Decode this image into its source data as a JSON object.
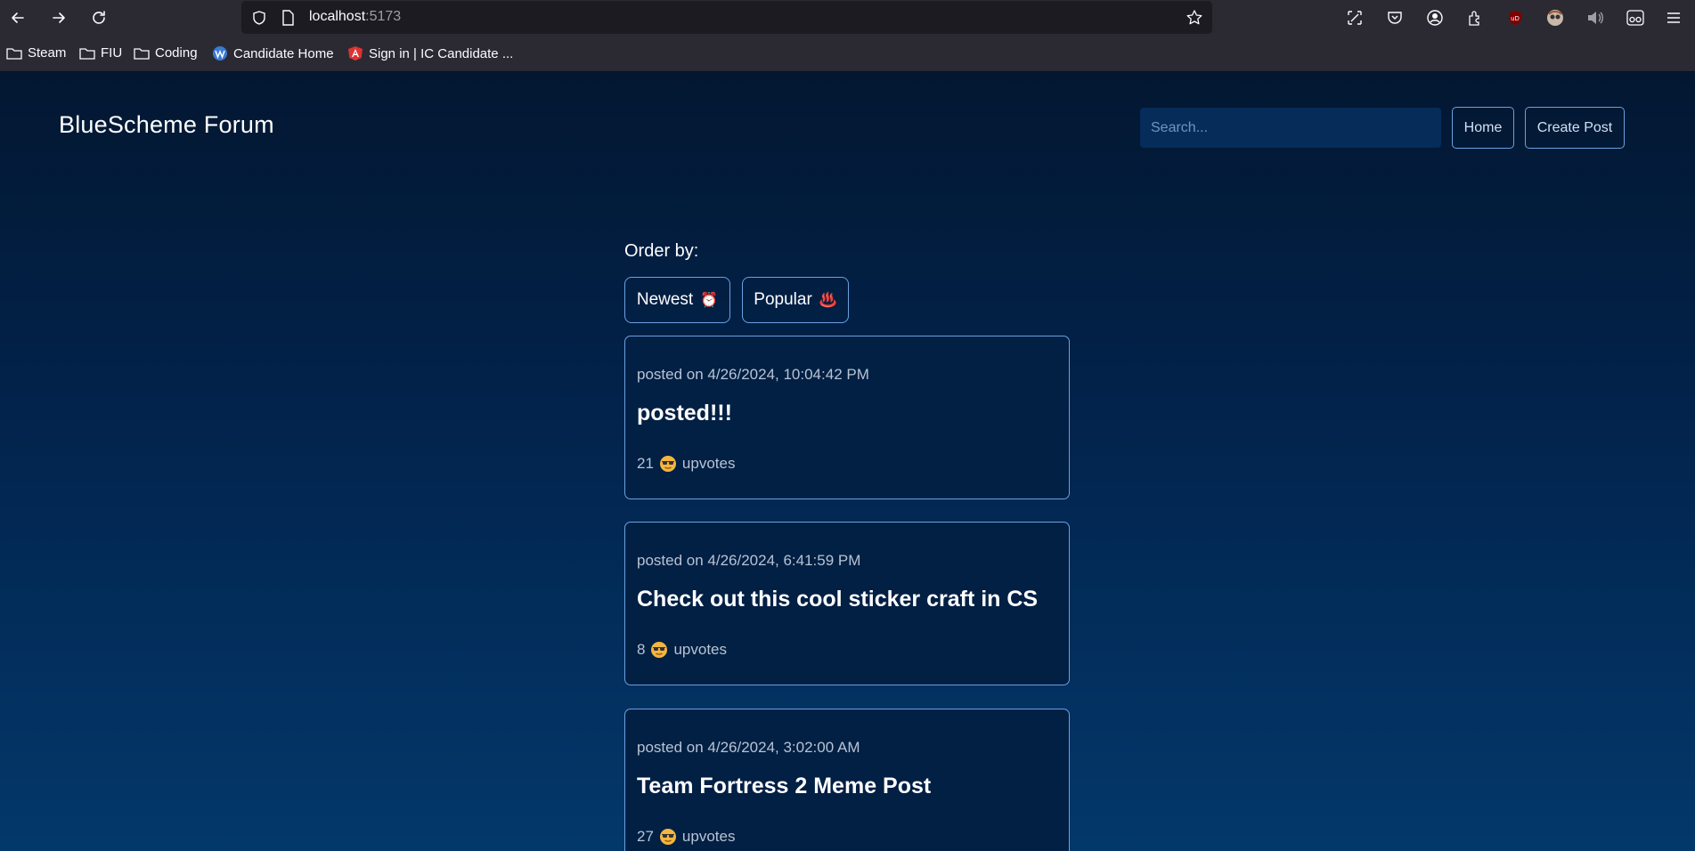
{
  "browser": {
    "url_host": "localhost",
    "url_port": ":5173",
    "bookmarks": [
      {
        "label": "Steam",
        "icon": "folder-icon"
      },
      {
        "label": "FIU",
        "icon": "folder-icon"
      },
      {
        "label": "Coding",
        "icon": "folder-icon"
      },
      {
        "label": "Candidate Home",
        "icon": "candidate-logo-icon"
      },
      {
        "label": "Sign in | IC Candidate ...",
        "icon": "angular-logo-icon"
      }
    ]
  },
  "header": {
    "title": "BlueScheme Forum",
    "search_placeholder": "Search...",
    "home_label": "Home",
    "create_label": "Create Post"
  },
  "sort": {
    "label": "Order by:",
    "newest_label": "Newest",
    "newest_icon": "⏰",
    "popular_label": "Popular",
    "popular_icon": "♨️"
  },
  "posts": [
    {
      "date": "posted on 4/26/2024, 10:04:42 PM",
      "title": "posted!!!",
      "votes": "21",
      "votes_suffix": "upvotes"
    },
    {
      "date": "posted on 4/26/2024, 6:41:59 PM",
      "title": "Check out this cool sticker craft in CS",
      "votes": "8",
      "votes_suffix": "upvotes"
    },
    {
      "date": "posted on 4/26/2024, 3:02:00 AM",
      "title": "Team Fortress 2 Meme Post",
      "votes": "27",
      "votes_suffix": "upvotes"
    }
  ],
  "colors": {
    "accent_border": "#6aa1e0",
    "card_bg": "#021f44",
    "page_gradient_top": "#031731",
    "page_gradient_bottom": "#03386b"
  }
}
